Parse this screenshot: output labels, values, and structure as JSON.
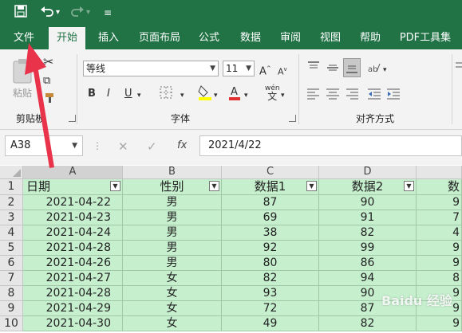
{
  "quick_access": {
    "save_icon": "save-icon",
    "undo_icon": "undo-icon",
    "redo_icon": "redo-icon",
    "customize_icon": "customize-qat-icon"
  },
  "tabs": [
    "文件",
    "开始",
    "插入",
    "页面布局",
    "公式",
    "数据",
    "审阅",
    "视图",
    "帮助",
    "PDF工具集"
  ],
  "active_tab": "开始",
  "ribbon": {
    "clipboard": {
      "paste_label": "粘贴",
      "group_label": "剪贴板"
    },
    "font": {
      "name": "等线",
      "size": "11",
      "bold": "B",
      "italic": "I",
      "underline": "U",
      "group_label": "字体",
      "phonetic": "wén"
    },
    "alignment": {
      "group_label": "对齐方式"
    }
  },
  "formula_bar": {
    "name_box": "A38",
    "cancel": "✕",
    "enter": "✓",
    "fx": "fx",
    "value": "2021/4/22"
  },
  "columns": [
    "A",
    "B",
    "C",
    "D"
  ],
  "selected_column": "A",
  "rows": [
    {
      "num": "1",
      "a": "日期",
      "b": "性别",
      "c": "数据1",
      "d": "数据2",
      "e": "数"
    },
    {
      "num": "2",
      "a": "2021-04-22",
      "b": "男",
      "c": "87",
      "d": "90",
      "e": "9"
    },
    {
      "num": "3",
      "a": "2021-04-23",
      "b": "男",
      "c": "69",
      "d": "91",
      "e": "7"
    },
    {
      "num": "4",
      "a": "2021-04-24",
      "b": "男",
      "c": "38",
      "d": "82",
      "e": "4"
    },
    {
      "num": "5",
      "a": "2021-04-28",
      "b": "男",
      "c": "92",
      "d": "99",
      "e": "9"
    },
    {
      "num": "6",
      "a": "2021-04-26",
      "b": "男",
      "c": "80",
      "d": "86",
      "e": "9"
    },
    {
      "num": "7",
      "a": "2021-04-27",
      "b": "女",
      "c": "82",
      "d": "94",
      "e": "8"
    },
    {
      "num": "8",
      "a": "2021-04-28",
      "b": "女",
      "c": "93",
      "d": "90",
      "e": "9"
    },
    {
      "num": "9",
      "a": "2021-04-29",
      "b": "女",
      "c": "72",
      "d": "87",
      "e": "9"
    },
    {
      "num": "10",
      "a": "2021-04-30",
      "b": "女",
      "c": "49",
      "d": "82",
      "e": "9"
    }
  ],
  "watermark": "Baidu 经验",
  "colors": {
    "ribbon_green": "#217346",
    "cell_fill": "#c6efce",
    "arrow_red": "#e8334a"
  }
}
